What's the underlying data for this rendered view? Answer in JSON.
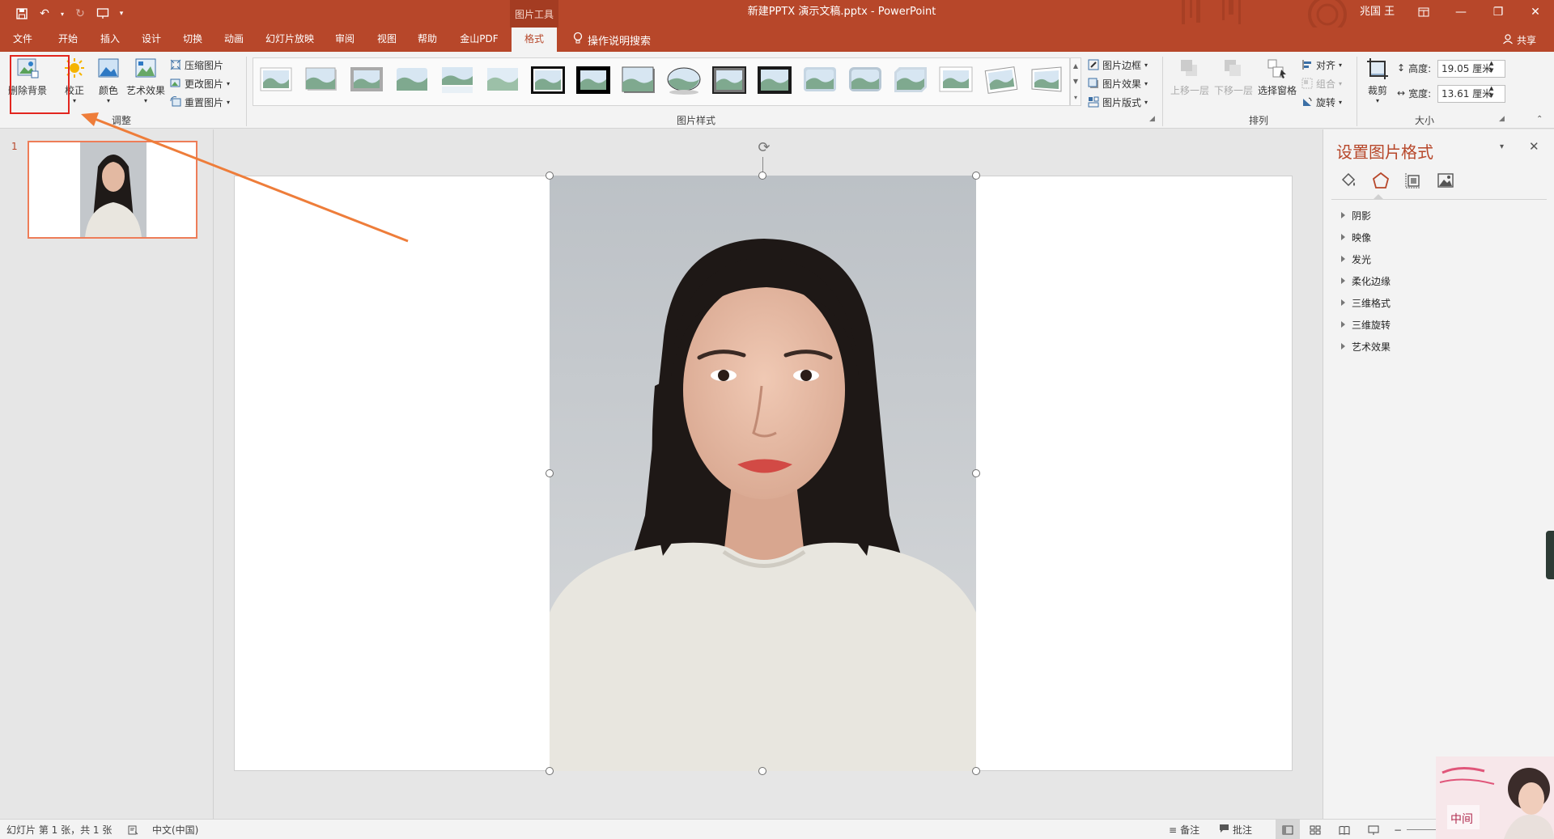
{
  "titlebar": {
    "context_tools": "图片工具",
    "doc_title": "新建PPTX 演示文稿.pptx  -  PowerPoint",
    "user": "兆国 王",
    "accent": "#b7472a"
  },
  "tabs": {
    "file": "文件",
    "home": "开始",
    "insert": "插入",
    "design": "设计",
    "transitions": "切换",
    "animations": "动画",
    "slideshow": "幻灯片放映",
    "review": "审阅",
    "view": "视图",
    "help": "帮助",
    "wps_pdf": "金山PDF",
    "format": "格式",
    "tell_me": "操作说明搜索",
    "share": "共享"
  },
  "ribbon": {
    "adjust": {
      "remove_bg": "删除背景",
      "corrections": "校正",
      "color": "颜色",
      "artistic": "艺术效果",
      "compress": "压缩图片",
      "change": "更改图片",
      "reset": "重置图片",
      "label": "调整"
    },
    "styles": {
      "label": "图片样式",
      "border": "图片边框",
      "effects": "图片效果",
      "layout": "图片版式"
    },
    "arrange": {
      "bring_forward": "上移一层",
      "send_backward": "下移一层",
      "selection_pane": "选择窗格",
      "align": "对齐",
      "group": "组合",
      "rotate": "旋转",
      "label": "排列"
    },
    "size": {
      "crop": "裁剪",
      "height_label": "高度:",
      "height_value": "19.05 厘米",
      "width_label": "宽度:",
      "width_value": "13.61 厘米",
      "label": "大小"
    }
  },
  "thumbs": {
    "slide_number": "1"
  },
  "format_pane": {
    "title": "设置图片格式",
    "sections": [
      "阴影",
      "映像",
      "发光",
      "柔化边缘",
      "三维格式",
      "三维旋转",
      "艺术效果"
    ]
  },
  "status": {
    "slide_info": "幻灯片 第 1 张，共 1 张",
    "language": "中文(中国)",
    "notes": "备注",
    "comments": "批注"
  },
  "sticker": {
    "text": "中间"
  }
}
